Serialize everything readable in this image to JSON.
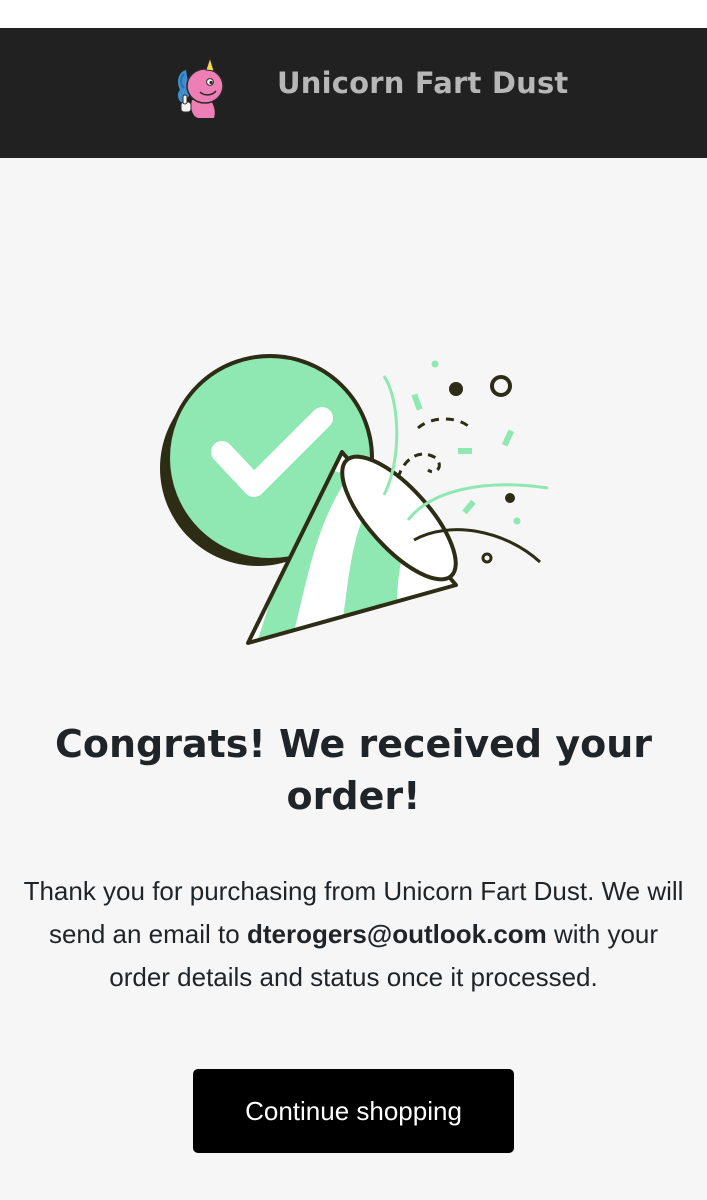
{
  "header": {
    "brand_name": "Unicorn Fart Dust",
    "logo_icon": "unicorn-mascot-icon",
    "background": "#212121"
  },
  "illustration": {
    "icons": [
      "checkmark-circle-icon",
      "party-popper-icon",
      "confetti-icon"
    ],
    "accent_color": "#8fe8b1"
  },
  "confirmation": {
    "headline": "Congrats! We received your order!",
    "message_before_email": "Thank you for purchasing from Unicorn Fart Dust. We will send an email to ",
    "email": "dterogers@outlook.com",
    "message_after_email": " with your order details and status once it processed."
  },
  "actions": {
    "continue_label": "Continue shopping",
    "button_color": "#000000"
  }
}
